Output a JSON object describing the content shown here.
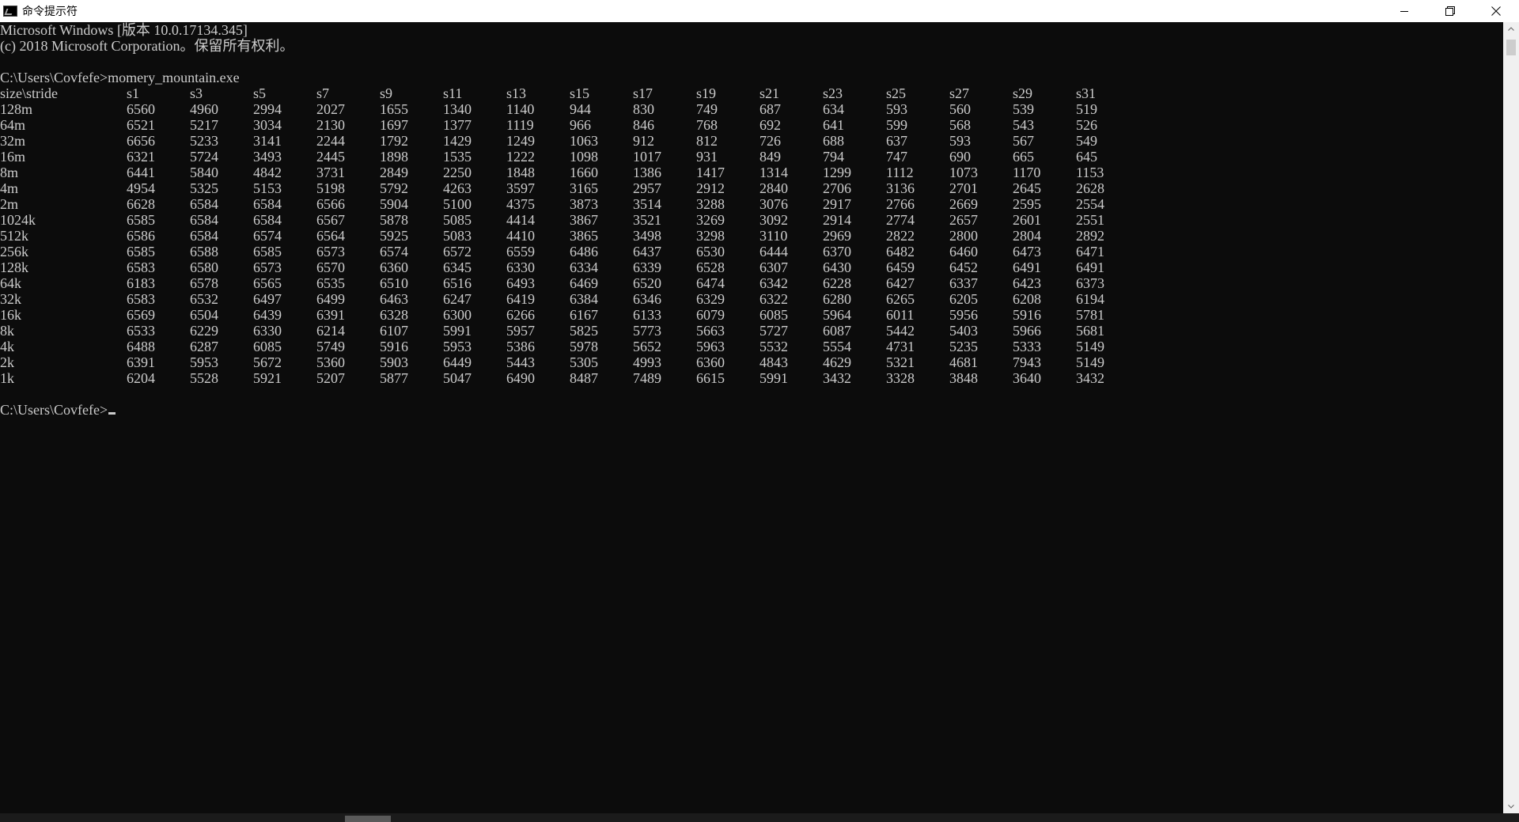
{
  "window": {
    "title": "命令提示符",
    "controls": {
      "minimize_icon": "minimize-icon",
      "maximize_icon": "restore-icon",
      "close_icon": "close-icon"
    }
  },
  "console": {
    "header_lines": [
      "Microsoft Windows [版本 10.0.17134.345]",
      "(c) 2018 Microsoft Corporation。保留所有权利。",
      "",
      "C:\\Users\\Covfefe>momery_mountain.exe"
    ],
    "table": {
      "columns": [
        "size\\stride",
        "s1",
        "s3",
        "s5",
        "s7",
        "s9",
        "s11",
        "s13",
        "s15",
        "s17",
        "s19",
        "s21",
        "s23",
        "s25",
        "s27",
        "s29",
        "s31"
      ],
      "rows": [
        [
          "128m",
          "6560",
          "4960",
          "2994",
          "2027",
          "1655",
          "1340",
          "1140",
          "944",
          "830",
          "749",
          "687",
          "634",
          "593",
          "560",
          "539",
          "519"
        ],
        [
          "64m",
          "6521",
          "5217",
          "3034",
          "2130",
          "1697",
          "1377",
          "1119",
          "966",
          "846",
          "768",
          "692",
          "641",
          "599",
          "568",
          "543",
          "526"
        ],
        [
          "32m",
          "6656",
          "5233",
          "3141",
          "2244",
          "1792",
          "1429",
          "1249",
          "1063",
          "912",
          "812",
          "726",
          "688",
          "637",
          "593",
          "567",
          "549"
        ],
        [
          "16m",
          "6321",
          "5724",
          "3493",
          "2445",
          "1898",
          "1535",
          "1222",
          "1098",
          "1017",
          "931",
          "849",
          "794",
          "747",
          "690",
          "665",
          "645"
        ],
        [
          "8m",
          "6441",
          "5840",
          "4842",
          "3731",
          "2849",
          "2250",
          "1848",
          "1660",
          "1386",
          "1417",
          "1314",
          "1299",
          "1112",
          "1073",
          "1170",
          "1153"
        ],
        [
          "4m",
          "4954",
          "5325",
          "5153",
          "5198",
          "5792",
          "4263",
          "3597",
          "3165",
          "2957",
          "2912",
          "2840",
          "2706",
          "3136",
          "2701",
          "2645",
          "2628"
        ],
        [
          "2m",
          "6628",
          "6584",
          "6584",
          "6566",
          "5904",
          "5100",
          "4375",
          "3873",
          "3514",
          "3288",
          "3076",
          "2917",
          "2766",
          "2669",
          "2595",
          "2554"
        ],
        [
          "1024k",
          "6585",
          "6584",
          "6584",
          "6567",
          "5878",
          "5085",
          "4414",
          "3867",
          "3521",
          "3269",
          "3092",
          "2914",
          "2774",
          "2657",
          "2601",
          "2551"
        ],
        [
          "512k",
          "6586",
          "6584",
          "6574",
          "6564",
          "5925",
          "5083",
          "4410",
          "3865",
          "3498",
          "3298",
          "3110",
          "2969",
          "2822",
          "2800",
          "2804",
          "2892"
        ],
        [
          "256k",
          "6585",
          "6588",
          "6585",
          "6573",
          "6574",
          "6572",
          "6559",
          "6486",
          "6437",
          "6530",
          "6444",
          "6370",
          "6482",
          "6460",
          "6473",
          "6471"
        ],
        [
          "128k",
          "6583",
          "6580",
          "6573",
          "6570",
          "6360",
          "6345",
          "6330",
          "6334",
          "6339",
          "6528",
          "6307",
          "6430",
          "6459",
          "6452",
          "6491",
          "6491"
        ],
        [
          "64k",
          "6183",
          "6578",
          "6565",
          "6535",
          "6510",
          "6516",
          "6493",
          "6469",
          "6520",
          "6474",
          "6342",
          "6228",
          "6427",
          "6337",
          "6423",
          "6373"
        ],
        [
          "32k",
          "6583",
          "6532",
          "6497",
          "6499",
          "6463",
          "6247",
          "6419",
          "6384",
          "6346",
          "6329",
          "6322",
          "6280",
          "6265",
          "6205",
          "6208",
          "6194"
        ],
        [
          "16k",
          "6569",
          "6504",
          "6439",
          "6391",
          "6328",
          "6300",
          "6266",
          "6167",
          "6133",
          "6079",
          "6085",
          "5964",
          "6011",
          "5956",
          "5916",
          "5781"
        ],
        [
          "8k",
          "6533",
          "6229",
          "6330",
          "6214",
          "6107",
          "5991",
          "5957",
          "5825",
          "5773",
          "5663",
          "5727",
          "6087",
          "5442",
          "5403",
          "5966",
          "5681"
        ],
        [
          "4k",
          "6488",
          "6287",
          "6085",
          "5749",
          "5916",
          "5953",
          "5386",
          "5978",
          "5652",
          "5963",
          "5532",
          "5554",
          "4731",
          "5235",
          "5333",
          "5149"
        ],
        [
          "2k",
          "6391",
          "5953",
          "5672",
          "5360",
          "5903",
          "6449",
          "5443",
          "5305",
          "4993",
          "6360",
          "4843",
          "4629",
          "5321",
          "4681",
          "7943",
          "5149"
        ],
        [
          "1k",
          "6204",
          "5528",
          "5921",
          "5207",
          "5877",
          "5047",
          "6490",
          "8487",
          "7489",
          "6615",
          "5991",
          "3432",
          "3328",
          "3848",
          "3640",
          "3432"
        ]
      ]
    },
    "prompt": "C:\\Users\\Covfefe>"
  },
  "colors": {
    "console_bg": "#0c0c0c",
    "console_fg": "#cccccc",
    "titlebar_bg": "#ffffff"
  }
}
